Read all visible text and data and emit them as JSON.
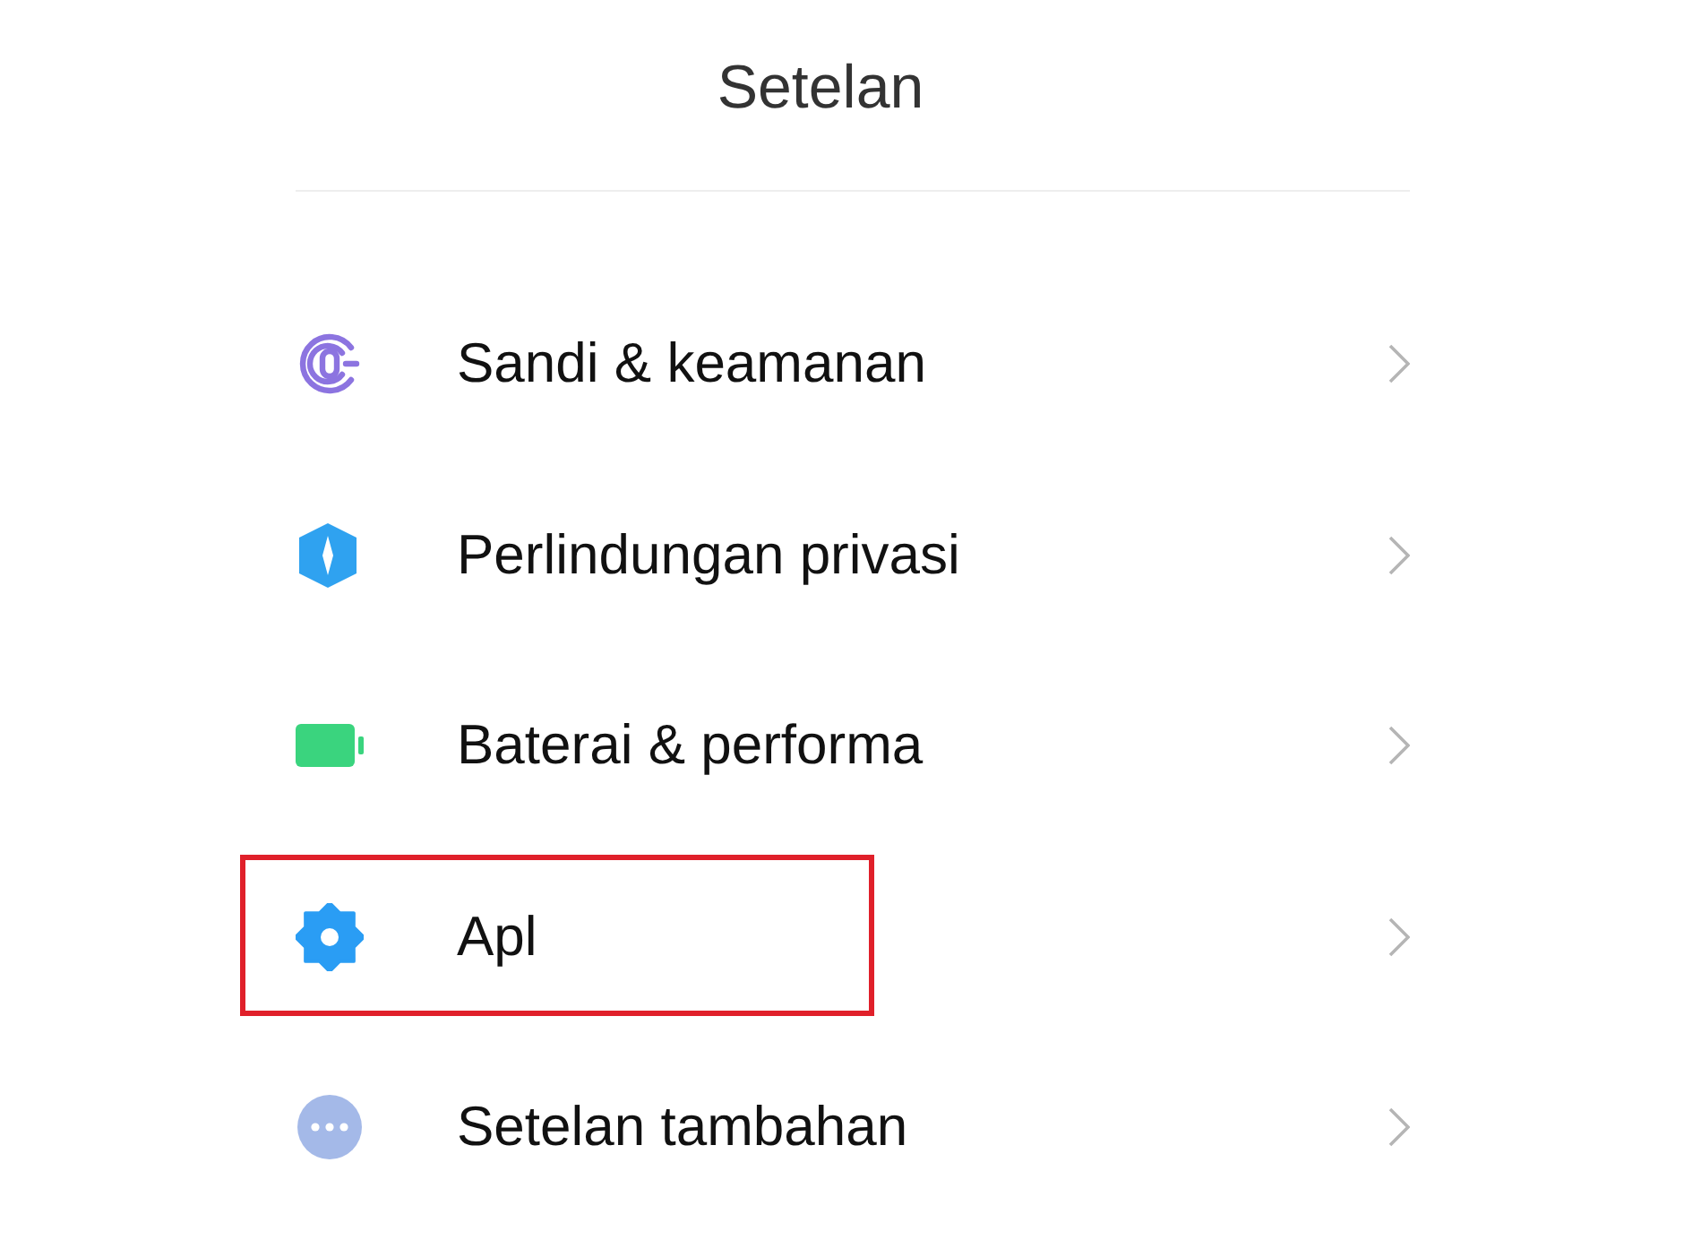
{
  "header": {
    "title": "Setelan"
  },
  "items": [
    {
      "label": "Sandi & keamanan",
      "kind": "fingerprint",
      "highlighted": false
    },
    {
      "label": "Perlindungan privasi",
      "kind": "shield",
      "highlighted": false
    },
    {
      "label": "Baterai & performa",
      "kind": "battery",
      "highlighted": false
    },
    {
      "label": "Apl",
      "kind": "gear",
      "highlighted": true
    },
    {
      "label": "Setelan tambahan",
      "kind": "more",
      "highlighted": false
    }
  ]
}
